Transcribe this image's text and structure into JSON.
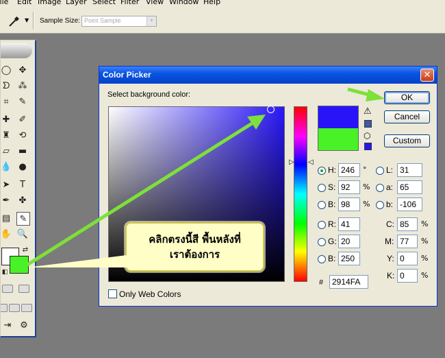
{
  "menu": [
    "File",
    "Edit",
    "Image",
    "Layer",
    "Select",
    "Filter",
    "View",
    "Window",
    "Help"
  ],
  "options_bar": {
    "sample_size_label": "Sample Size:",
    "sample_size_value": "Point Sample"
  },
  "toolbox": {
    "foreground_color": "#ffffff",
    "background_color": "#48f226"
  },
  "dialog": {
    "title": "Color Picker",
    "prompt": "Select background color:",
    "buttons": {
      "ok": "OK",
      "cancel": "Cancel",
      "custom": "Custom"
    },
    "new_color": "#2914fa",
    "old_color": "#48f226",
    "fields": {
      "H": {
        "label": "H:",
        "value": "246",
        "unit": "°"
      },
      "S": {
        "label": "S:",
        "value": "92",
        "unit": "%"
      },
      "B": {
        "label": "B:",
        "value": "98",
        "unit": "%"
      },
      "R": {
        "label": "R:",
        "value": "41"
      },
      "G": {
        "label": "G:",
        "value": "20"
      },
      "Bl": {
        "label": "B:",
        "value": "250"
      },
      "L": {
        "label": "L:",
        "value": "31"
      },
      "a": {
        "label": "a:",
        "value": "65"
      },
      "b": {
        "label": "b:",
        "value": "-106"
      },
      "C": {
        "label": "C:",
        "value": "85",
        "unit": "%"
      },
      "M": {
        "label": "M:",
        "value": "77",
        "unit": "%"
      },
      "Y": {
        "label": "Y:",
        "value": "0",
        "unit": "%"
      },
      "K": {
        "label": "K:",
        "value": "0",
        "unit": "%"
      }
    },
    "hex_label": "#",
    "hex_value": "2914FA",
    "only_web_colors": "Only Web Colors"
  },
  "callout": {
    "line1": "คลิกตรงนี้สี พื้นหลังที่",
    "line2": "เราต้องการ"
  },
  "colors": {
    "arrow": "#7ee03a",
    "titlebar": "#0a54e3",
    "callout_bg": "#fffec7"
  }
}
